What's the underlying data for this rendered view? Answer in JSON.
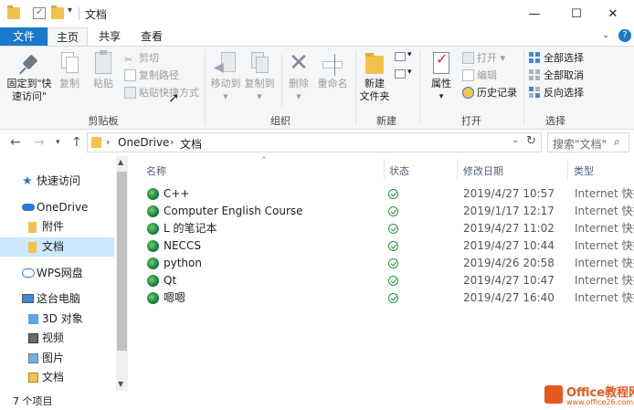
{
  "window": {
    "title": "文档",
    "minimize": "—",
    "maximize": "☐",
    "close": "✕"
  },
  "tabs": {
    "file": "文件",
    "home": "主页",
    "share": "共享",
    "view": "查看"
  },
  "ribbon": {
    "clipboard": {
      "pin": "固定到\"快",
      "pin2": "速访问\"",
      "copy": "复制",
      "paste": "粘贴",
      "cut": "剪切",
      "copy_path": "复制路径",
      "paste_shortcut": "粘贴快捷方式",
      "label": "剪贴板"
    },
    "organize": {
      "move_to": "移动到",
      "copy_to": "复制到",
      "delete": "删除",
      "rename": "重命名",
      "label": "组织"
    },
    "new": {
      "new_folder": "新建",
      "new_folder2": "文件夹",
      "label": "新建"
    },
    "open": {
      "properties": "属性",
      "open": "打开",
      "edit": "编辑",
      "history": "历史记录",
      "label": "打开"
    },
    "select": {
      "select_all": "全部选择",
      "select_none": "全部取消",
      "invert": "反向选择",
      "label": "选择"
    }
  },
  "address": {
    "path": [
      "OneDrive",
      "文档"
    ],
    "separator": "›",
    "search_placeholder": "搜索\"文档\""
  },
  "nav": {
    "quick_access": "快速访问",
    "onedrive": "OneDrive",
    "attachments": "附件",
    "documents": "文档",
    "wps": "WPS网盘",
    "this_pc": "这台电脑",
    "objects3d": "3D 对象",
    "videos": "视频",
    "pictures": "图片",
    "pc_documents": "文档"
  },
  "columns": {
    "name": "名称",
    "status": "状态",
    "modified": "修改日期",
    "type": "类型"
  },
  "files": [
    {
      "name": "C++",
      "date": "2019/4/27 10:57",
      "type": "Internet 快捷"
    },
    {
      "name": "Computer English Course",
      "date": "2019/1/17 12:17",
      "type": "Internet 快捷"
    },
    {
      "name": "L 的笔记本",
      "date": "2019/4/27 11:02",
      "type": "Internet 快捷"
    },
    {
      "name": "NECCS",
      "date": "2019/4/27 10:44",
      "type": "Internet 快捷"
    },
    {
      "name": "python",
      "date": "2019/4/26 20:58",
      "type": "Internet 快捷"
    },
    {
      "name": "Qt",
      "date": "2019/4/27 10:47",
      "type": "Internet 快捷"
    },
    {
      "name": "嗯嗯",
      "date": "2019/4/27 16:40",
      "type": "Internet 快捷"
    }
  ],
  "status": {
    "count": "7 个项目"
  },
  "watermark": {
    "line1": "Office教程网",
    "line2": "www.office26.com"
  }
}
